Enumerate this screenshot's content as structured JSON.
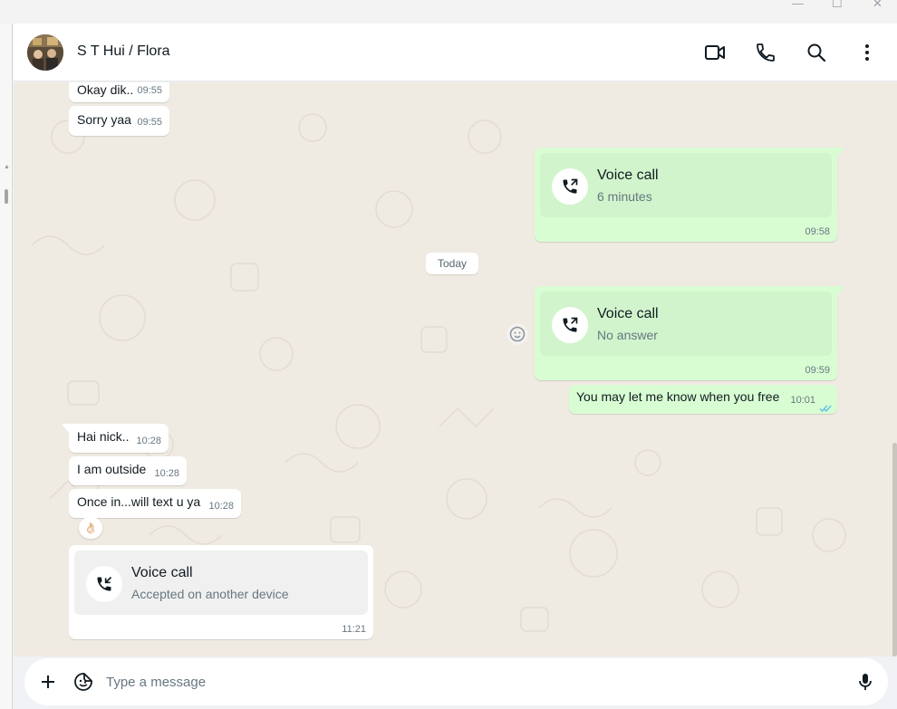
{
  "window": {
    "minimize": "—",
    "maximize": "☐",
    "close": "✕"
  },
  "header": {
    "contact_name": "S T Hui / Flora",
    "icons": [
      "video-call-icon",
      "voice-call-icon",
      "search-icon",
      "menu-icon"
    ]
  },
  "messages": [
    {
      "dir": "in",
      "text": "Okay dik..",
      "time": "09:55"
    },
    {
      "dir": "in",
      "text": "Sorry yaa",
      "time": "09:55"
    },
    {
      "dir": "out",
      "type": "call",
      "title": "Voice call",
      "subtitle": "6 minutes",
      "time": "09:58"
    },
    {
      "type": "date",
      "text": "Today"
    },
    {
      "dir": "out",
      "type": "call",
      "title": "Voice call",
      "subtitle": "No answer",
      "time": "09:59"
    },
    {
      "dir": "out",
      "text": "You may let me know when you free",
      "time": "10:01",
      "status": "read"
    },
    {
      "dir": "in",
      "text": "Hai nick..",
      "time": "10:28"
    },
    {
      "dir": "in",
      "text": "I am outside",
      "time": "10:28"
    },
    {
      "dir": "in",
      "text": "Once in...will text u ya",
      "time": "10:28",
      "reaction": "👌🏻"
    },
    {
      "dir": "in",
      "type": "call",
      "title": "Voice call",
      "subtitle": "Accepted on another device",
      "time": "11:21"
    }
  ],
  "composer": {
    "placeholder": "Type a message"
  },
  "colors": {
    "outgoing": "#d9fdd3",
    "incoming": "#ffffff",
    "background": "#efeae2",
    "read_ticks": "#53bdeb"
  }
}
